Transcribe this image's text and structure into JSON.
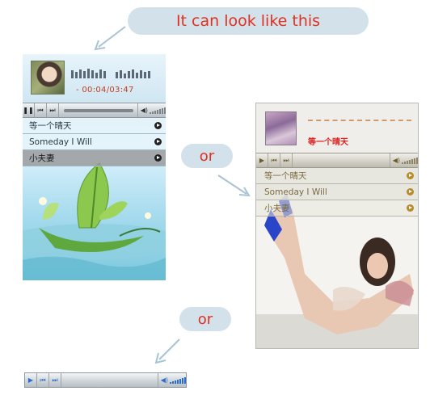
{
  "callouts": {
    "top": "It can look like this",
    "or1": "or",
    "or2": "or"
  },
  "player1": {
    "time": "- 00:04/03:47",
    "playlist": [
      "等一个晴天",
      "Someday I Will",
      "小夫妻"
    ],
    "selected_index": 2
  },
  "player2": {
    "title": "等一个晴天",
    "playlist": [
      "等一个晴天",
      "Someday I Will",
      "小夫妻"
    ],
    "selected_index": 2
  },
  "colors": {
    "callout_text": "#e03020",
    "callout_bg": "#d3e2ea",
    "player1_time": "#c04020",
    "player2_title": "#dd2222",
    "player2_text": "#7a6a40",
    "player3_buttons": "#2a6ccd"
  },
  "icons": [
    "pause-icon",
    "previous-icon",
    "next-icon",
    "play-icon",
    "volume-icon"
  ]
}
